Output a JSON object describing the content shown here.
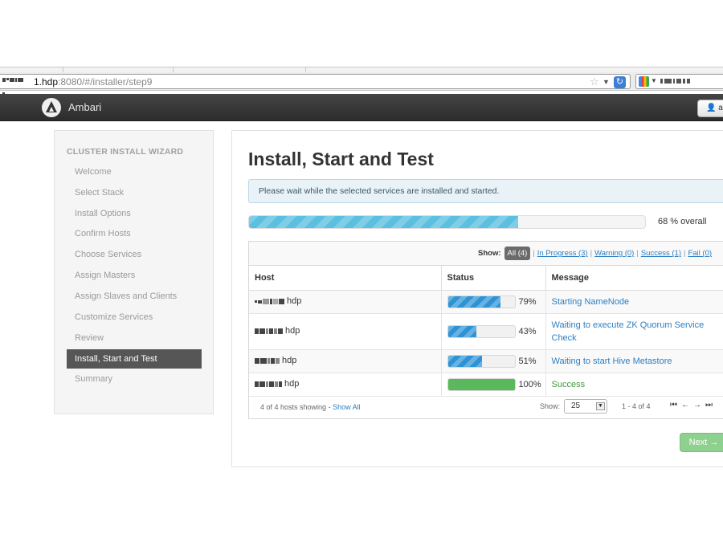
{
  "browser": {
    "url_host": "1.hdp",
    "url_rest": ":8080/#/installer/step9",
    "icons": {
      "star": "star-icon",
      "reload": "reload-icon",
      "search_engine": "google-icon"
    }
  },
  "header": {
    "brand": "Ambari",
    "user_button": "ad",
    "icons": {
      "logo": "ambari-logo-icon",
      "user": "user-icon"
    }
  },
  "sidebar": {
    "title": "CLUSTER INSTALL WIZARD",
    "items": [
      {
        "label": "Welcome"
      },
      {
        "label": "Select Stack"
      },
      {
        "label": "Install Options"
      },
      {
        "label": "Confirm Hosts"
      },
      {
        "label": "Choose Services"
      },
      {
        "label": "Assign Masters"
      },
      {
        "label": "Assign Slaves and Clients"
      },
      {
        "label": "Customize Services"
      },
      {
        "label": "Review"
      },
      {
        "label": "Install, Start and Test",
        "active": true
      },
      {
        "label": "Summary"
      }
    ]
  },
  "main": {
    "title": "Install, Start and Test",
    "alert": "Please wait while the selected services are installed and started.",
    "overall": {
      "percent": 68,
      "value_text": "68",
      "suffix": "% overall"
    },
    "filters": {
      "show_label": "Show:",
      "all": "All (4)",
      "in_progress": "In Progress (3)",
      "warning": "Warning (0)",
      "success": "Success (1)",
      "fail": "Fail (0)"
    },
    "table": {
      "columns": {
        "host": "Host",
        "status": "Status",
        "message": "Message"
      },
      "rows": [
        {
          "host_suffix": "hdp",
          "percent": 79,
          "percent_text": "79%",
          "message": "Starting NameNode",
          "state": "in-progress"
        },
        {
          "host_suffix": "hdp",
          "percent": 43,
          "percent_text": "43%",
          "message": "Waiting to execute ZK Quorum Service Check",
          "state": "in-progress"
        },
        {
          "host_suffix": "hdp",
          "percent": 51,
          "percent_text": "51%",
          "message": "Waiting to start Hive Metastore",
          "state": "in-progress"
        },
        {
          "host_suffix": "hdp",
          "percent": 100,
          "percent_text": "100%",
          "message": "Success",
          "state": "success"
        }
      ]
    },
    "footer": {
      "hosts_showing": "4 of 4 hosts showing",
      "dash": "-",
      "show_all": "Show All",
      "show_label": "Show:",
      "page_size": "25",
      "range": "1 - 4 of 4",
      "pager_icons": [
        "first-page-icon",
        "prev-page-icon",
        "next-page-icon",
        "last-page-icon"
      ]
    },
    "next_button": "Next →"
  },
  "colors": {
    "topbar": "#333333",
    "progress_stripe": "#5bbfe0",
    "status_bar": "#2e93d5",
    "success": "#5cb85c",
    "link": "#2a7fc4",
    "active_nav": "#565656"
  }
}
